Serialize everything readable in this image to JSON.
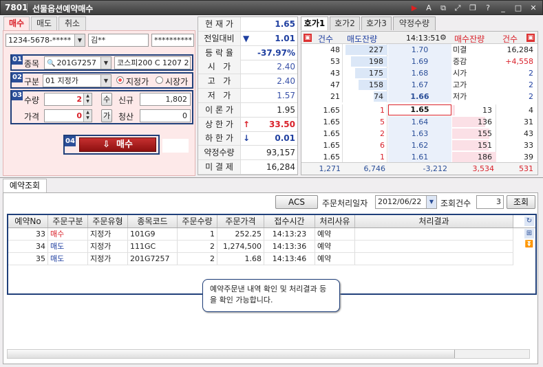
{
  "window": {
    "number": "7801",
    "title": "선물옵션예약매수"
  },
  "order_tabs": [
    "매수",
    "매도",
    "취소"
  ],
  "account": {
    "number": "1234-5678-*****",
    "name": "김**",
    "password": "**********"
  },
  "form": {
    "symbol_label": "종목",
    "symbol_code": "201G7257",
    "symbol_name": "코스피200 C 1207 2",
    "type_label": "구분",
    "type_value": "01 지정가",
    "radio_limit": "지정가",
    "radio_market": "시장가",
    "qty_label": "수량",
    "qty_value": "2",
    "qty_unit": "수",
    "new_label": "신규",
    "new_value": "1,802",
    "price_label": "가격",
    "price_value": "0",
    "price_unit": "가",
    "liquidate_label": "청산",
    "liquidate_value": "0",
    "buy_button": "매수",
    "badges": [
      "01",
      "02",
      "03",
      "04"
    ]
  },
  "quote": {
    "rows": [
      {
        "label": "현 재 가",
        "arrow": "",
        "value": "1.65",
        "color": "#1f3fa0",
        "bold": true
      },
      {
        "label": "전일대비",
        "arrow": "▼",
        "value": "1.01",
        "color": "#1f3fa0",
        "bold": true
      },
      {
        "label": "등 락 율",
        "arrow": "",
        "value": "-37.97%",
        "color": "#1f3fa0",
        "bold": true
      },
      {
        "label": "시   가",
        "arrow": "",
        "value": "2.40",
        "color": "#3a52a8",
        "bold": false
      },
      {
        "label": "고   가",
        "arrow": "",
        "value": "2.40",
        "color": "#3a52a8",
        "bold": false
      },
      {
        "label": "저   가",
        "arrow": "",
        "value": "1.57",
        "color": "#3a52a8",
        "bold": false
      },
      {
        "label": "이 론 가",
        "arrow": "",
        "value": "1.95",
        "color": "#222222",
        "bold": false
      },
      {
        "label": "상 한 가",
        "arrow": "↑",
        "value": "33.50",
        "color": "#d9212a",
        "bold": true
      },
      {
        "label": "하 한 가",
        "arrow": "↓",
        "value": "0.01",
        "color": "#1f3fa0",
        "bold": true
      },
      {
        "label": "약정수량",
        "arrow": "",
        "value": "93,157",
        "color": "#222222",
        "bold": false
      },
      {
        "label": "미 결 제",
        "arrow": "",
        "value": "16,284",
        "color": "#222222",
        "bold": false
      }
    ]
  },
  "hoga": {
    "tabs": [
      "호가1",
      "호가2",
      "호가3",
      "약정수량"
    ],
    "header": {
      "count": "건수",
      "sell_qty": "매도잔량",
      "time": "14:13:51",
      "buy_qty": "매수잔량",
      "count2": "건수"
    },
    "ask_rows": [
      {
        "count": "48",
        "qty": "227",
        "price": "1.70",
        "fill": 0.95,
        "side_label": "미결",
        "side_value": "16,284",
        "side_color": "#222222"
      },
      {
        "count": "53",
        "qty": "198",
        "price": "1.69",
        "fill": 0.83,
        "side_label": "증감",
        "side_value": "+4,558",
        "side_color": "#d9212a"
      },
      {
        "count": "43",
        "qty": "175",
        "price": "1.68",
        "fill": 0.73,
        "side_label": "시가",
        "side_value": "2",
        "side_color": "#1f3fa0"
      },
      {
        "count": "47",
        "qty": "158",
        "price": "1.67",
        "fill": 0.66,
        "side_label": "고가",
        "side_value": "2",
        "side_color": "#1f3fa0"
      },
      {
        "count": "21",
        "qty": "74",
        "price": "1.66",
        "fill": 0.31,
        "side_label": "저가",
        "side_value": "2",
        "side_color": "#1f3fa0"
      }
    ],
    "bid_rows": [
      {
        "left_price": "1.65",
        "left_qty": "1",
        "price": "1.65",
        "qty": "13",
        "count": "4",
        "fill": 0.07
      },
      {
        "left_price": "1.65",
        "left_qty": "5",
        "price": "1.64",
        "qty": "136",
        "count": "31",
        "fill": 0.75
      },
      {
        "left_price": "1.65",
        "left_qty": "2",
        "price": "1.63",
        "qty": "155",
        "count": "43",
        "fill": 0.85
      },
      {
        "left_price": "1.65",
        "left_qty": "6",
        "price": "1.62",
        "qty": "151",
        "count": "33",
        "fill": 0.83
      },
      {
        "left_price": "1.65",
        "left_qty": "1",
        "price": "1.61",
        "qty": "186",
        "count": "39",
        "fill": 1.0
      }
    ],
    "footer": {
      "count": "1,271",
      "sell_total": "6,746",
      "diff": "-3,212",
      "buy_total": "3,534",
      "count2": "531"
    }
  },
  "bottom": {
    "tab": "예약조회",
    "acs_button": "ACS",
    "date_label": "주문처리일자",
    "date_value": "2012/06/22",
    "count_label": "조회건수",
    "count_value": "3",
    "query_button": "조회",
    "columns": [
      "예약No",
      "주문구분",
      "주문유형",
      "종목코드",
      "주문수량",
      "주문가격",
      "접수시간",
      "처리사유",
      "처리결과"
    ],
    "rows": [
      {
        "no": "33",
        "side": "매수",
        "side_color": "#d9212a",
        "type": "지정가",
        "code": "101G9",
        "qty": "1",
        "price": "252.25",
        "time": "14:13:23",
        "reason": "예약",
        "result": ""
      },
      {
        "no": "34",
        "side": "매도",
        "side_color": "#1f3fa0",
        "type": "지정가",
        "code": "111GC",
        "qty": "2",
        "price": "1,274,500",
        "time": "14:13:36",
        "reason": "예약",
        "result": ""
      },
      {
        "no": "35",
        "side": "매도",
        "side_color": "#1f3fa0",
        "type": "지정가",
        "code": "201G7257",
        "qty": "2",
        "price": "1.68",
        "time": "14:13:46",
        "reason": "예약",
        "result": ""
      }
    ],
    "tooltip": "예약주문낸 내역 확인 및 처리결과 등을 확인 가능합니다."
  }
}
